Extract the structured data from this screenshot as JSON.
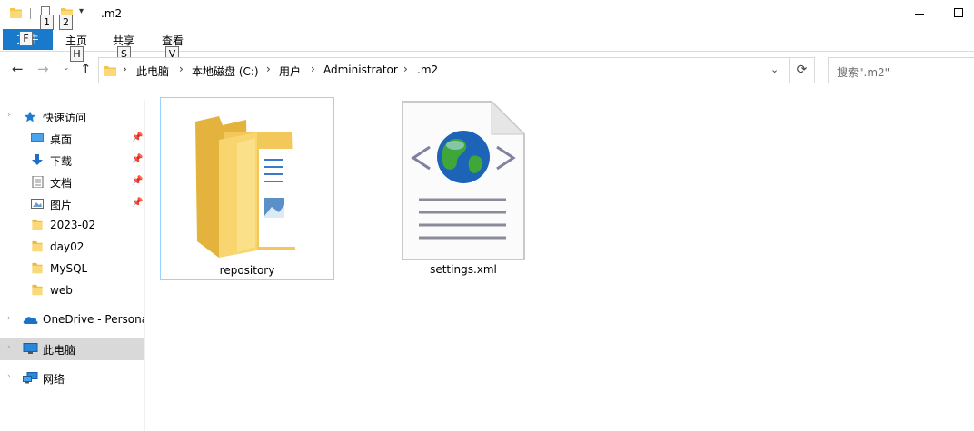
{
  "window": {
    "title": ".m2",
    "keytips": [
      "1",
      "2"
    ]
  },
  "ribbon": {
    "file_tab": "文件",
    "file_keytip": "F",
    "tabs": [
      {
        "label": "主页",
        "keytip": "H"
      },
      {
        "label": "共享",
        "keytip": "S"
      },
      {
        "label": "查看",
        "keytip": "V"
      }
    ]
  },
  "nav": {
    "breadcrumb": [
      "此电脑",
      "本地磁盘 (C:)",
      "用户",
      "Administrator",
      ".m2"
    ],
    "search_placeholder": "搜索\".m2\""
  },
  "sidebar": {
    "quick_access": "快速访问",
    "items": [
      {
        "label": "桌面",
        "icon": "desktop-icon",
        "pinned": true
      },
      {
        "label": "下载",
        "icon": "download-icon",
        "pinned": true
      },
      {
        "label": "文档",
        "icon": "document-icon",
        "pinned": true
      },
      {
        "label": "图片",
        "icon": "picture-icon",
        "pinned": true
      },
      {
        "label": "2023-02",
        "icon": "folder-icon",
        "pinned": false
      },
      {
        "label": "day02",
        "icon": "folder-icon",
        "pinned": false
      },
      {
        "label": "MySQL",
        "icon": "folder-icon",
        "pinned": false
      },
      {
        "label": "web",
        "icon": "folder-icon",
        "pinned": false
      }
    ],
    "onedrive": "OneDrive - Persona",
    "this_pc": "此电脑",
    "network": "网络"
  },
  "content": {
    "items": [
      {
        "name": "repository",
        "type": "folder",
        "selected": true
      },
      {
        "name": "settings.xml",
        "type": "xml-file",
        "selected": false
      }
    ]
  },
  "colors": {
    "accent": "#1979ca",
    "folder": "#f7d774",
    "selection_border": "#99d1ff",
    "sidebar_selected": "#d9d9d9"
  }
}
